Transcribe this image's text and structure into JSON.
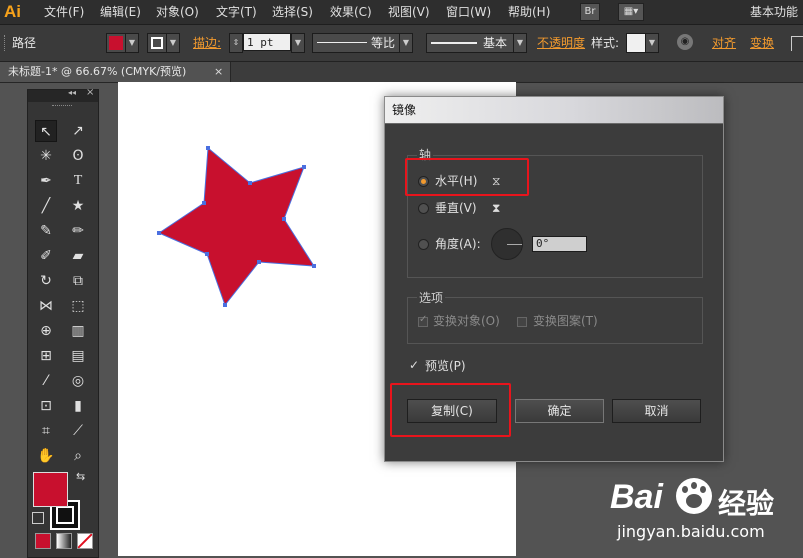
{
  "app": {
    "logo": "Ai"
  },
  "menu": [
    {
      "label": "文件(F)"
    },
    {
      "label": "编辑(E)"
    },
    {
      "label": "对象(O)"
    },
    {
      "label": "文字(T)"
    },
    {
      "label": "选择(S)"
    },
    {
      "label": "效果(C)"
    },
    {
      "label": "视图(V)"
    },
    {
      "label": "窗口(W)"
    },
    {
      "label": "帮助(H)"
    }
  ],
  "menu_right": {
    "bridge": "Br",
    "workspace": "基本功能"
  },
  "control": {
    "selection_type": "路径",
    "fill_color": "#c8102e",
    "stroke_label": "描边:",
    "stroke_weight": "1 pt",
    "profile_label": "等比",
    "brush_label": "基本",
    "opacity_label": "不透明度",
    "style_label": "样式:",
    "align_label": "对齐",
    "transform_label": "变换"
  },
  "document": {
    "tab_title": "未标题-1* @ 66.67% (CMYK/预览)",
    "close": "×"
  },
  "star": {
    "fill": "#c8102e",
    "stroke": "#4a6fe0"
  },
  "tools_panel": {
    "collapse": "◂◂",
    "close": "×"
  },
  "dialog": {
    "title": "镜像",
    "axis_group": "轴",
    "horizontal": "水平(H)",
    "vertical": "垂直(V)",
    "angle": "角度(A):",
    "angle_value": "0°",
    "options_group": "选项",
    "transform_objects": "变换对象(O)",
    "transform_patterns": "变换图案(T)",
    "preview": "预览(P)",
    "copy_button": "复制(C)",
    "ok_button": "确定",
    "cancel_button": "取消"
  },
  "watermark": {
    "brand": "Bai",
    "brand2": "经验",
    "url": "jingyan.baidu.com"
  },
  "colors": {
    "accent": "#f29a2e",
    "highlight": "#e8141c"
  }
}
